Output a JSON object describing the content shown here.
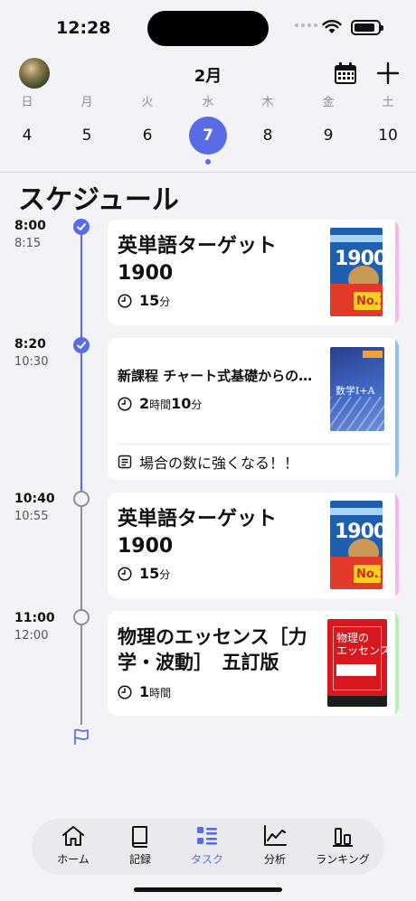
{
  "status_bar": {
    "time": "12:28"
  },
  "header": {
    "month": "2月"
  },
  "week": [
    {
      "dow": "日",
      "num": "4"
    },
    {
      "dow": "月",
      "num": "5"
    },
    {
      "dow": "火",
      "num": "6"
    },
    {
      "dow": "水",
      "num": "7",
      "selected": true
    },
    {
      "dow": "木",
      "num": "8"
    },
    {
      "dow": "金",
      "num": "9"
    },
    {
      "dow": "土",
      "num": "10"
    }
  ],
  "section_title": "スケジュール",
  "schedule": [
    {
      "start": "8:00",
      "end": "8:15",
      "done": true,
      "title": "英単語ターゲット1900",
      "duration_big": "15",
      "duration_unit": "分",
      "stripe_color": "#f7b6e8"
    },
    {
      "start": "8:20",
      "end": "10:30",
      "done": true,
      "title": "新課程 チャート式基礎からの…",
      "duration_big1": "2",
      "duration_unit1": "時間",
      "duration_big2": "10",
      "duration_unit2": "分",
      "memo": "場合の数に強くなる！！",
      "cover_label": "数学Ⅰ+A",
      "stripe_color": "#8fc0f6"
    },
    {
      "start": "10:40",
      "end": "10:55",
      "done": false,
      "title": "英単語ターゲット1900",
      "duration_big": "15",
      "duration_unit": "分",
      "stripe_color": "#f7b6e8"
    },
    {
      "start": "11:00",
      "end": "12:00",
      "done": false,
      "title": "物理のエッセンス［力学・波動］　五訂版",
      "duration_big": "1",
      "duration_unit": "時間",
      "cover_title": "物理の\nエッセンス",
      "stripe_color": "#b6f2b0"
    }
  ],
  "book_cover": {
    "target_number": "1900",
    "no1": "No.1"
  },
  "tabbar": [
    {
      "label": "ホーム",
      "icon": "home-icon"
    },
    {
      "label": "記録",
      "icon": "book-icon"
    },
    {
      "label": "タスク",
      "icon": "list-icon",
      "active": true
    },
    {
      "label": "分析",
      "icon": "chart-icon"
    },
    {
      "label": "ランキング",
      "icon": "bar-icon"
    }
  ],
  "colors": {
    "accent": "#5a6be6",
    "background": "#f2f2f7"
  }
}
